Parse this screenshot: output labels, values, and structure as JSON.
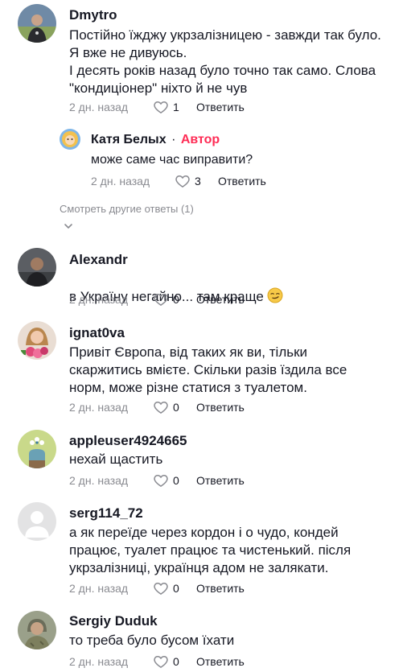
{
  "comments": [
    {
      "username": "Dmytro",
      "text": "Постійно їжджу укрзалізницею - завжди так було.\nЯ вже не дивуюсь.\nІ десять років назад було точно так само. Слова\n\"кондиціонер\" ніхто й не чув",
      "time": "2 дн. назад",
      "likes": "1",
      "reply_label": "Ответить",
      "avatar": "dmytro-avatar"
    },
    {
      "username": "Alexandr",
      "text": "в Україну негайно... там краще",
      "emoji": "smirk-emoji",
      "time": "2 дн. назад",
      "likes": "0",
      "reply_label": "Ответить",
      "avatar": "alexandr-avatar"
    },
    {
      "username": "ignat0va",
      "text": "Привіт Європа, від таких як ви, тільки\nскаржитись вмієте. Скільки разів їздила все\nнорм, може різне статися з туалетом.",
      "time": "2 дн. назад",
      "likes": "0",
      "reply_label": "Ответить",
      "avatar": "ignat0va-avatar"
    },
    {
      "username": "appleuser4924665",
      "text": "нехай щастить",
      "time": "2 дн. назад",
      "likes": "0",
      "reply_label": "Ответить",
      "avatar": "appleuser-avatar"
    },
    {
      "username": "serg114_72",
      "text": "а як переїде через кордон і о чудо, кондей\nпрацює, туалет працює та чистенький. після\nукрзалізниці, українця адом не залякати.",
      "time": "2 дн. назад",
      "likes": "0",
      "reply_label": "Ответить",
      "avatar": "default-avatar"
    },
    {
      "username": "Sergiy Duduk",
      "text": "то треба було бусом їхати",
      "time": "2 дн. назад",
      "likes": "0",
      "reply_label": "Ответить",
      "avatar": "sergiy-avatar"
    }
  ],
  "reply": {
    "username": "Катя Белых",
    "separator": "·",
    "author_tag": "Автор",
    "text": "може саме час виправити?",
    "time": "2 дн. назад",
    "likes": "3",
    "reply_label": "Ответить",
    "avatar": "katya-avatar"
  },
  "more_replies": {
    "label": "Смотреть другие ответы (1)",
    "icon": "chevron-down-icon"
  },
  "colors": {
    "text": "#161823",
    "muted": "#8a8b91",
    "author": "#fe2c55"
  }
}
